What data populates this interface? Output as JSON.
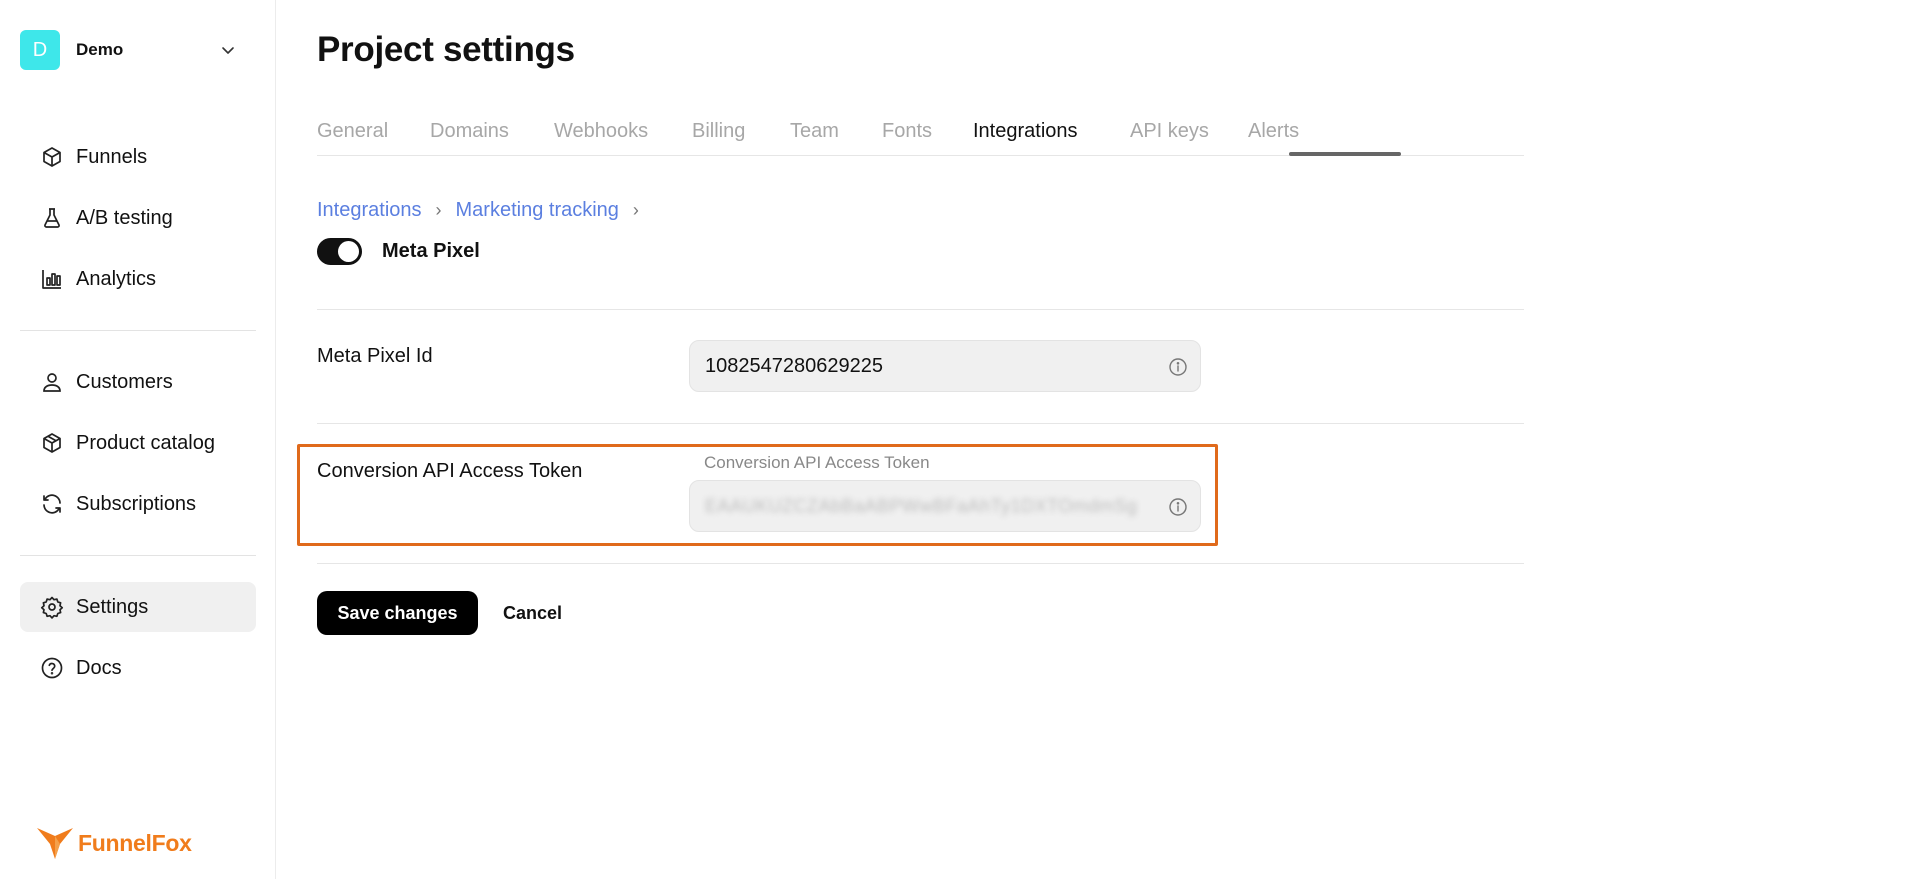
{
  "sidebar": {
    "workspace": {
      "initial": "D",
      "name": "Demo",
      "avatar_color": "#3ee7ea",
      "icon": "chevron-down-icon"
    },
    "items": [
      {
        "label": "Funnels",
        "icon": "cube-icon"
      },
      {
        "label": "A/B testing",
        "icon": "flask-icon"
      },
      {
        "label": "Analytics",
        "icon": "bar-chart-icon"
      },
      {
        "label": "Customers",
        "icon": "user-icon"
      },
      {
        "label": "Product catalog",
        "icon": "package-icon"
      },
      {
        "label": "Subscriptions",
        "icon": "refresh-icon"
      },
      {
        "label": "Settings",
        "icon": "gear-icon",
        "active": true
      },
      {
        "label": "Docs",
        "icon": "help-circle-icon"
      }
    ],
    "brand": {
      "name": "FunnelFox",
      "color": "#f07c1c"
    }
  },
  "main": {
    "title": "Project settings",
    "tabs": [
      {
        "label": "General"
      },
      {
        "label": "Domains"
      },
      {
        "label": "Webhooks"
      },
      {
        "label": "Billing"
      },
      {
        "label": "Team"
      },
      {
        "label": "Fonts"
      },
      {
        "label": "Integrations",
        "active": true
      },
      {
        "label": "API keys"
      },
      {
        "label": "Alerts"
      }
    ],
    "breadcrumb": [
      {
        "label": "Integrations"
      },
      {
        "label": "Marketing tracking"
      }
    ],
    "integration": {
      "label": "Meta Pixel",
      "enabled": true
    },
    "fields": {
      "pixel_id": {
        "label": "Meta Pixel Id",
        "value": "1082547280629225",
        "icon": "info-icon"
      },
      "access_token": {
        "label": "Conversion API Access Token",
        "floating_label": "Conversion API Access Token",
        "value": "EAAUKUZCZAbBaABPWwBFaAhTy1DXTOmdmSg",
        "icon": "info-icon"
      }
    },
    "actions": {
      "save_label": "Save changes",
      "cancel_label": "Cancel"
    },
    "highlight_color": "#e06a1b",
    "link_color": "#5b7fe0"
  }
}
